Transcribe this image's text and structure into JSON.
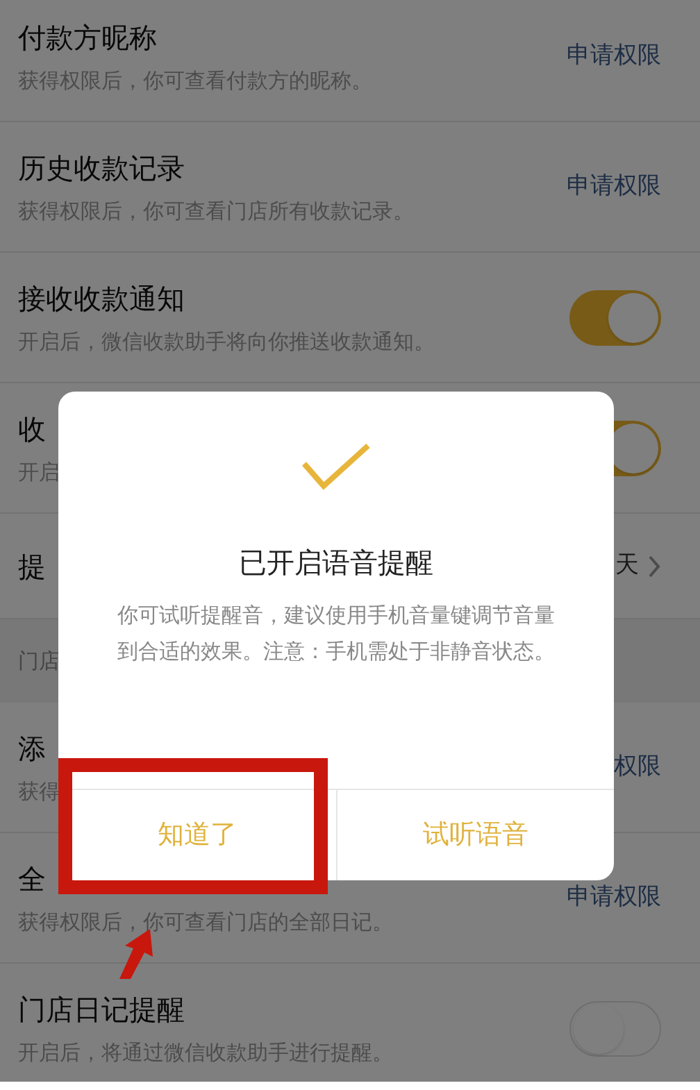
{
  "rows": [
    {
      "kind": "permission",
      "title": "付款方昵称",
      "subtitle": "获得权限后，你可查看付款方的昵称。",
      "action": "申请权限"
    },
    {
      "kind": "permission",
      "title": "历史收款记录",
      "subtitle": "获得权限后，你可查看门店所有收款记录。",
      "action": "申请权限"
    },
    {
      "kind": "toggle",
      "title": "接收收款通知",
      "subtitle": "开启后，微信收款助手将向你推送收款通知。",
      "on": true
    },
    {
      "kind": "toggle",
      "title": "收",
      "subtitle": "开启",
      "on": true
    },
    {
      "kind": "link",
      "title": "提",
      "value": "天"
    },
    {
      "kind": "section",
      "title": "门店"
    },
    {
      "kind": "permission",
      "title": "添",
      "subtitle": "获得",
      "action": "权限"
    },
    {
      "kind": "permission",
      "title": "全",
      "subtitle": "获得权限后，你可查看门店的全部日记。",
      "action": "申请权限"
    },
    {
      "kind": "toggle",
      "title": "门店日记提醒",
      "subtitle": "开启后，将通过微信收款助手进行提醒。",
      "on": false
    }
  ],
  "dialog": {
    "title": "已开启语音提醒",
    "message": "你可试听提醒音，建议使用手机音量键调节音量到合适的效果。注意：手机需处于非静音状态。",
    "buttons": [
      "知道了",
      "试听语音"
    ]
  }
}
